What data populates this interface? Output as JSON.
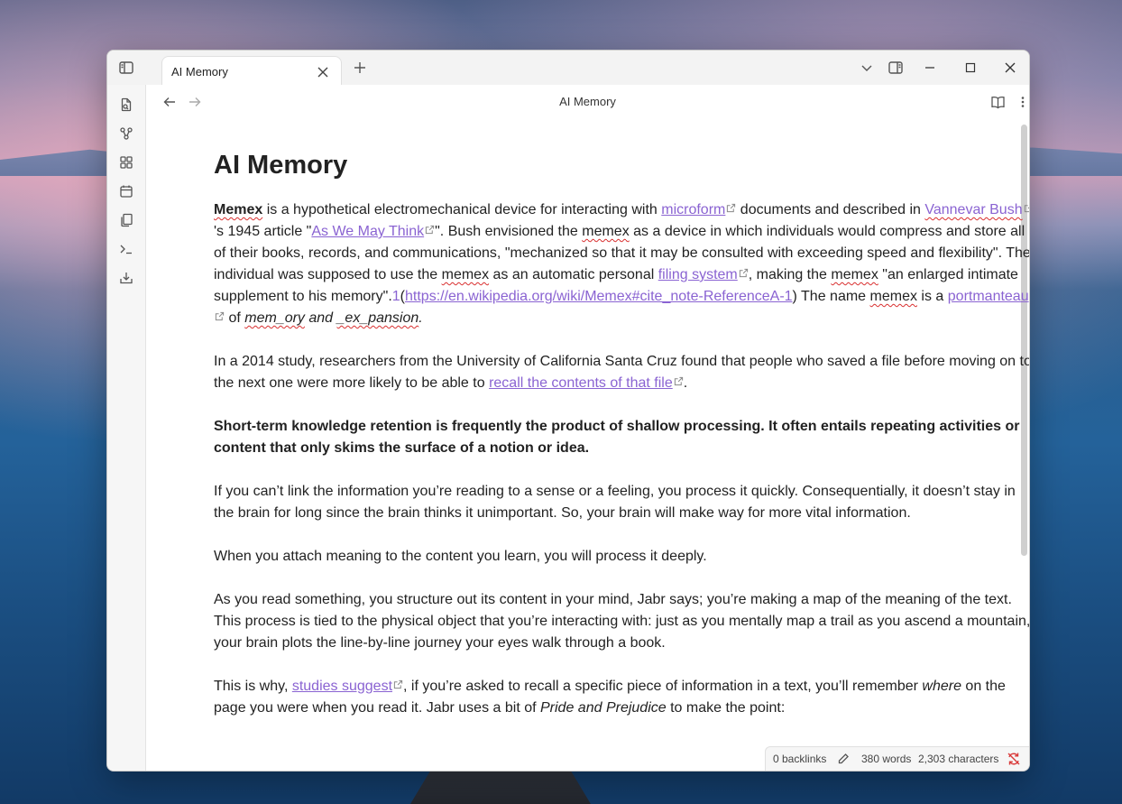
{
  "tab": {
    "title": "AI Memory"
  },
  "view_title": "AI Memory",
  "note": {
    "title": "AI Memory",
    "p1": {
      "s1": "Memex",
      "s2": " is a hypothetical electromechanical device for interacting with ",
      "link_microform": "microform",
      "s3": " documents and described in ",
      "link_bush": "Vannevar Bush",
      "s4": "'s 1945 article \"",
      "link_article": "As We May Think",
      "s5": "\". Bush envisioned the ",
      "memex1": "memex",
      "s6": " as a device in which individuals would compress and store all of their books, records, and communications, \"mechanized so that it may be consulted with exceeding speed and flexibility\". The individual was supposed to use the ",
      "memex2": "memex",
      "s7": " as an automatic personal ",
      "link_filing": "filing system",
      "s8": ", making the ",
      "memex3": "memex",
      "s9": " \"an enlarged intimate supplement to his memory\".",
      "fn": "1",
      "s10": "(",
      "link_wiki": "https://en.wikipedia.org/wiki/Memex#cite_note-ReferenceA-1",
      "s11": ") The name ",
      "memex4": "memex",
      "s12": " is a ",
      "link_portmanteau": "portmanteau",
      "s13": " of ",
      "mem_ory": "mem_ory",
      "s14": " and ",
      "ex_pansion": "_ex_pansion",
      "s15": "."
    },
    "p2": {
      "s1": "In a 2014 study, researchers from the University of California Santa Cruz found that people who saved a file before moving on to the next one were more likely to be able to ",
      "link": "recall the contents of that file",
      "s2": "."
    },
    "p3": "Short-term knowledge retention is frequently the product of shallow processing. It often entails repeating activities or content that only skims the surface of a notion or idea.",
    "p4": "If you can’t link the information you’re reading to a sense or a feeling, you process it quickly. Consequentially, it doesn’t stay in the brain for long since the brain thinks it unimportant. So, your brain will make way for more vital information.",
    "p5": "When you attach meaning to the content you learn, you will process it deeply.",
    "p6": "As you read something, you structure out its content in your mind, Jabr says; you’re making a map of the meaning of the text. This process is tied to the physical object that you’re interacting with: just as you mentally map a trail as you ascend a mountain, your brain plots the line-by-line journey your eyes walk through a book.",
    "p7": {
      "s1": "This is why, ",
      "link": "studies suggest",
      "s2": ", if you’re asked to recall a specific piece of information in a text, you’ll remember ",
      "em1": "where",
      "s3": " on the page you were when you read it. Jabr uses a bit of ",
      "em2": "Pride and Prejudice",
      "s4": " to make the point:"
    }
  },
  "status": {
    "backlinks": "0 backlinks",
    "words": "380 words",
    "characters": "2,303 characters"
  },
  "colors": {
    "link": "#8a63d2",
    "accent": "#7b5cd6"
  },
  "icons": {
    "ribbon": [
      "files-icon",
      "graph-icon",
      "canvas-icon",
      "calendar-icon",
      "templates-icon",
      "terminal-icon",
      "import-icon"
    ]
  }
}
